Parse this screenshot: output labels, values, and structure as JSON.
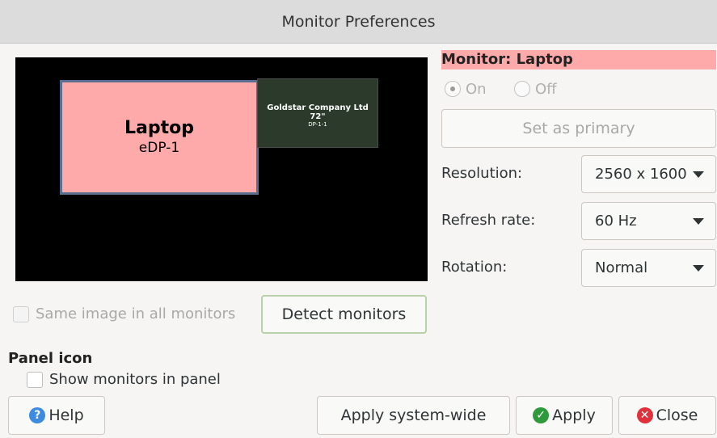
{
  "window": {
    "title": "Monitor Preferences"
  },
  "canvas": {
    "laptop": {
      "name": "Laptop",
      "connector": "eDP-1"
    },
    "external": {
      "name": "Goldstar Company Ltd 72\"",
      "connector": "DP-1-1"
    }
  },
  "monitor": {
    "header": "Monitor: Laptop",
    "on_label": "On",
    "off_label": "Off",
    "set_primary_label": "Set as primary"
  },
  "settings": {
    "resolution_label": "Resolution:",
    "resolution_value": "2560 x 1600",
    "refresh_label": "Refresh rate:",
    "refresh_value": "60 Hz",
    "rotation_label": "Rotation:",
    "rotation_value": "Normal"
  },
  "mirror": {
    "label": "Same image in all monitors"
  },
  "detect_label": "Detect monitors",
  "panel": {
    "title": "Panel icon",
    "show_label": "Show monitors in panel"
  },
  "buttons": {
    "help": "Help",
    "apply_system_wide": "Apply system-wide",
    "apply": "Apply",
    "close": "Close"
  },
  "colors": {
    "laptop_fill": "#ffaaaa",
    "external_fill": "#2b3a2b",
    "help_icon": "#3d8be0",
    "apply_icon": "#2e9a3c",
    "close_icon": "#e0323a"
  },
  "icons": {
    "help": "help-icon",
    "apply": "check-icon",
    "close": "close-icon"
  }
}
